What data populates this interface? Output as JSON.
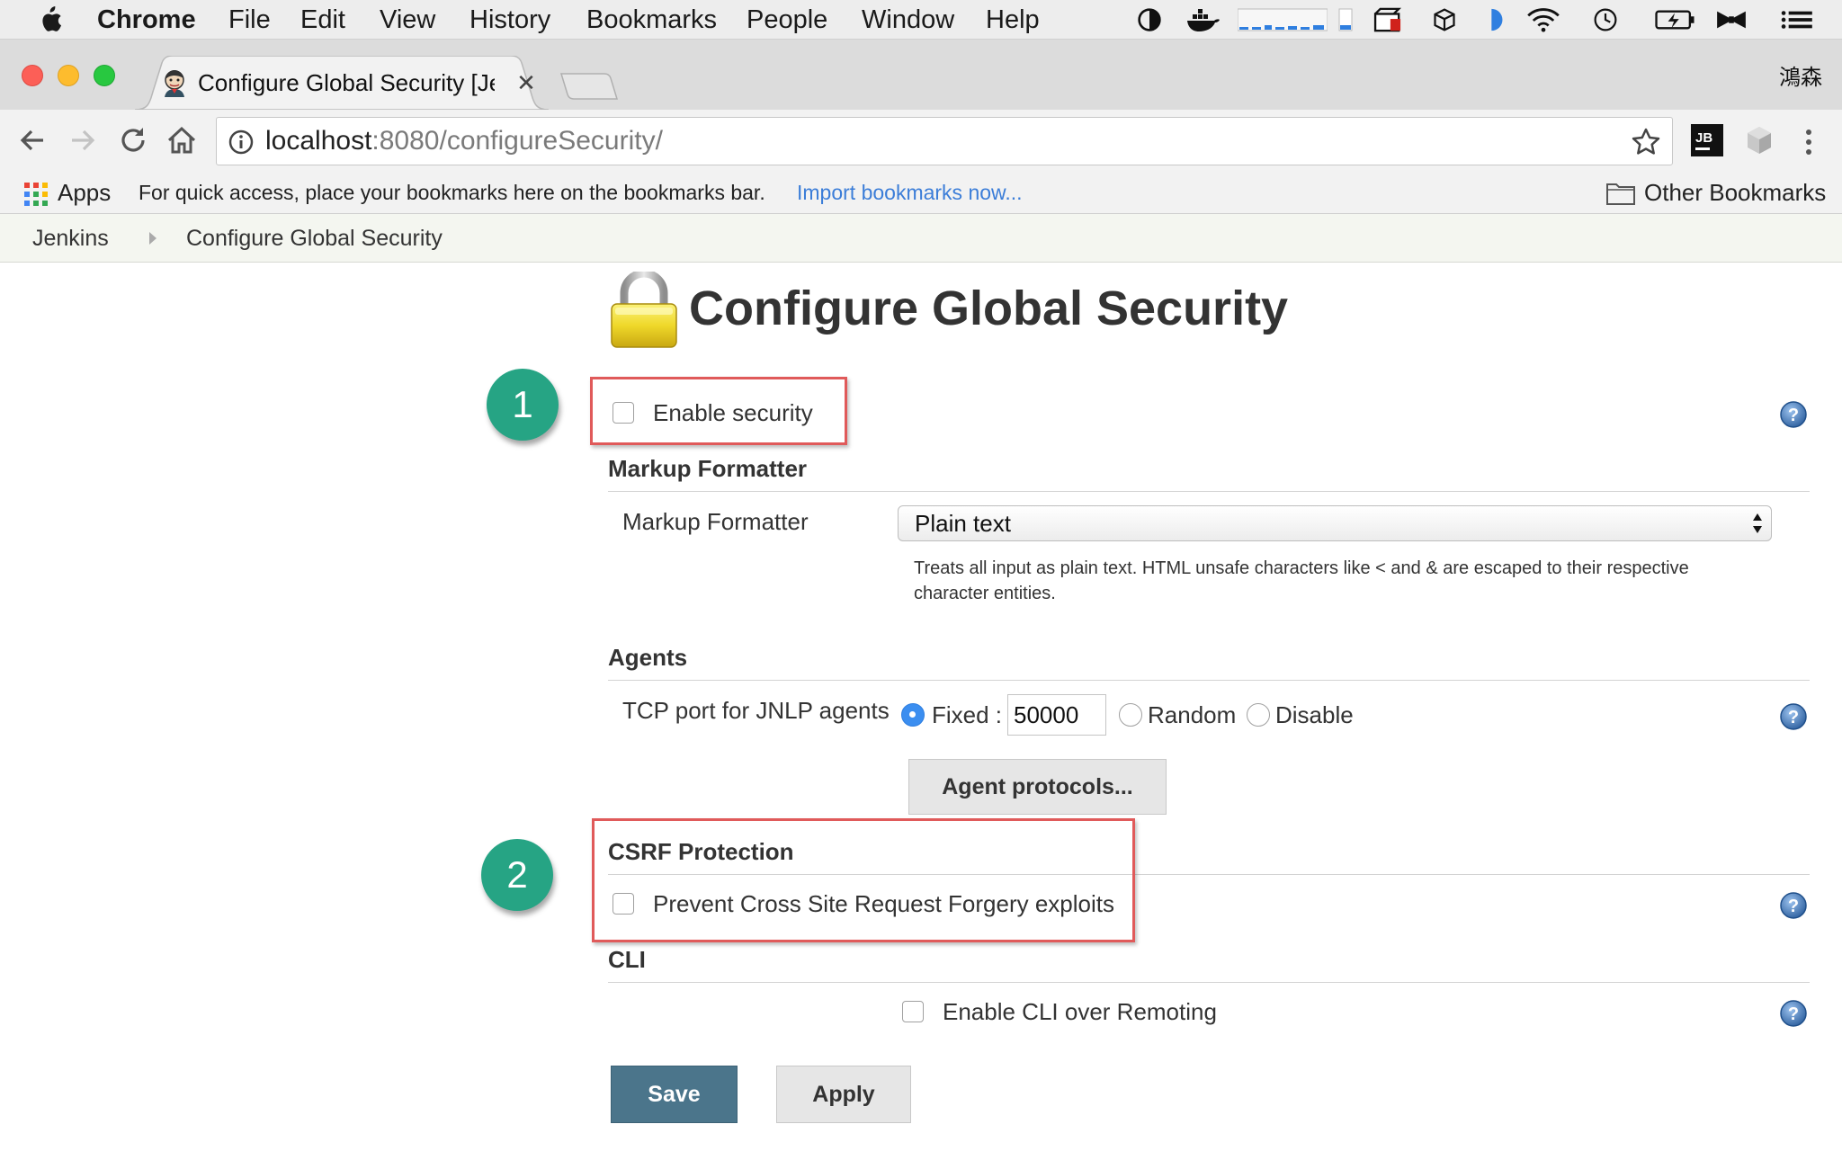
{
  "menubar": {
    "app_name": "Chrome",
    "menus": [
      "File",
      "Edit",
      "View",
      "History",
      "Bookmarks",
      "People",
      "Window",
      "Help"
    ],
    "tray_icons": [
      "contrast-icon",
      "docker-icon",
      "activity-graph-icon",
      "battery-level-icon",
      "screen-recorder-icon",
      "box-icon",
      "half-moon-icon",
      "wifi-icon",
      "time-machine-icon",
      "battery-charging-icon",
      "bowtie-icon",
      "list-icon"
    ]
  },
  "tabs": {
    "active_title": "Configure Global Security [Jenkins]",
    "profile_name": "鴻森"
  },
  "toolbar": {
    "url_host": "localhost",
    "url_path": ":8080/configureSecurity/"
  },
  "bookmarks_bar": {
    "apps_label": "Apps",
    "hint": "For quick access, place your bookmarks here on the bookmarks bar.",
    "import_link": "Import bookmarks now...",
    "other_label": "Other Bookmarks"
  },
  "breadcrumb": {
    "items": [
      "Jenkins",
      "Configure Global Security"
    ]
  },
  "page": {
    "title": "Configure Global Security",
    "enable_security_label": "Enable security",
    "enable_security_checked": false,
    "markup_section": "Markup Formatter",
    "markup_label": "Markup Formatter",
    "markup_selected": "Plain text",
    "markup_description": "Treats all input as plain text. HTML unsafe characters like < and & are escaped to their respective character entities.",
    "agents_section": "Agents",
    "tcp_label": "TCP port for JNLP agents",
    "tcp_options": [
      "Fixed :",
      "Random",
      "Disable"
    ],
    "tcp_selected": "Fixed :",
    "tcp_port_value": "50000",
    "agent_protocols_button": "Agent protocols...",
    "csrf_section": "CSRF Protection",
    "csrf_label": "Prevent Cross Site Request Forgery exploits",
    "csrf_checked": false,
    "cli_section": "CLI",
    "cli_label": "Enable CLI over Remoting",
    "cli_checked": false,
    "save_button": "Save",
    "apply_button": "Apply"
  },
  "annotations": {
    "step_1": "1",
    "step_2": "2"
  },
  "colors": {
    "save_button": "#4b758b",
    "annotation_circle": "#26a484",
    "highlight_box": "#e05a5a",
    "link": "#3b7dd8"
  }
}
